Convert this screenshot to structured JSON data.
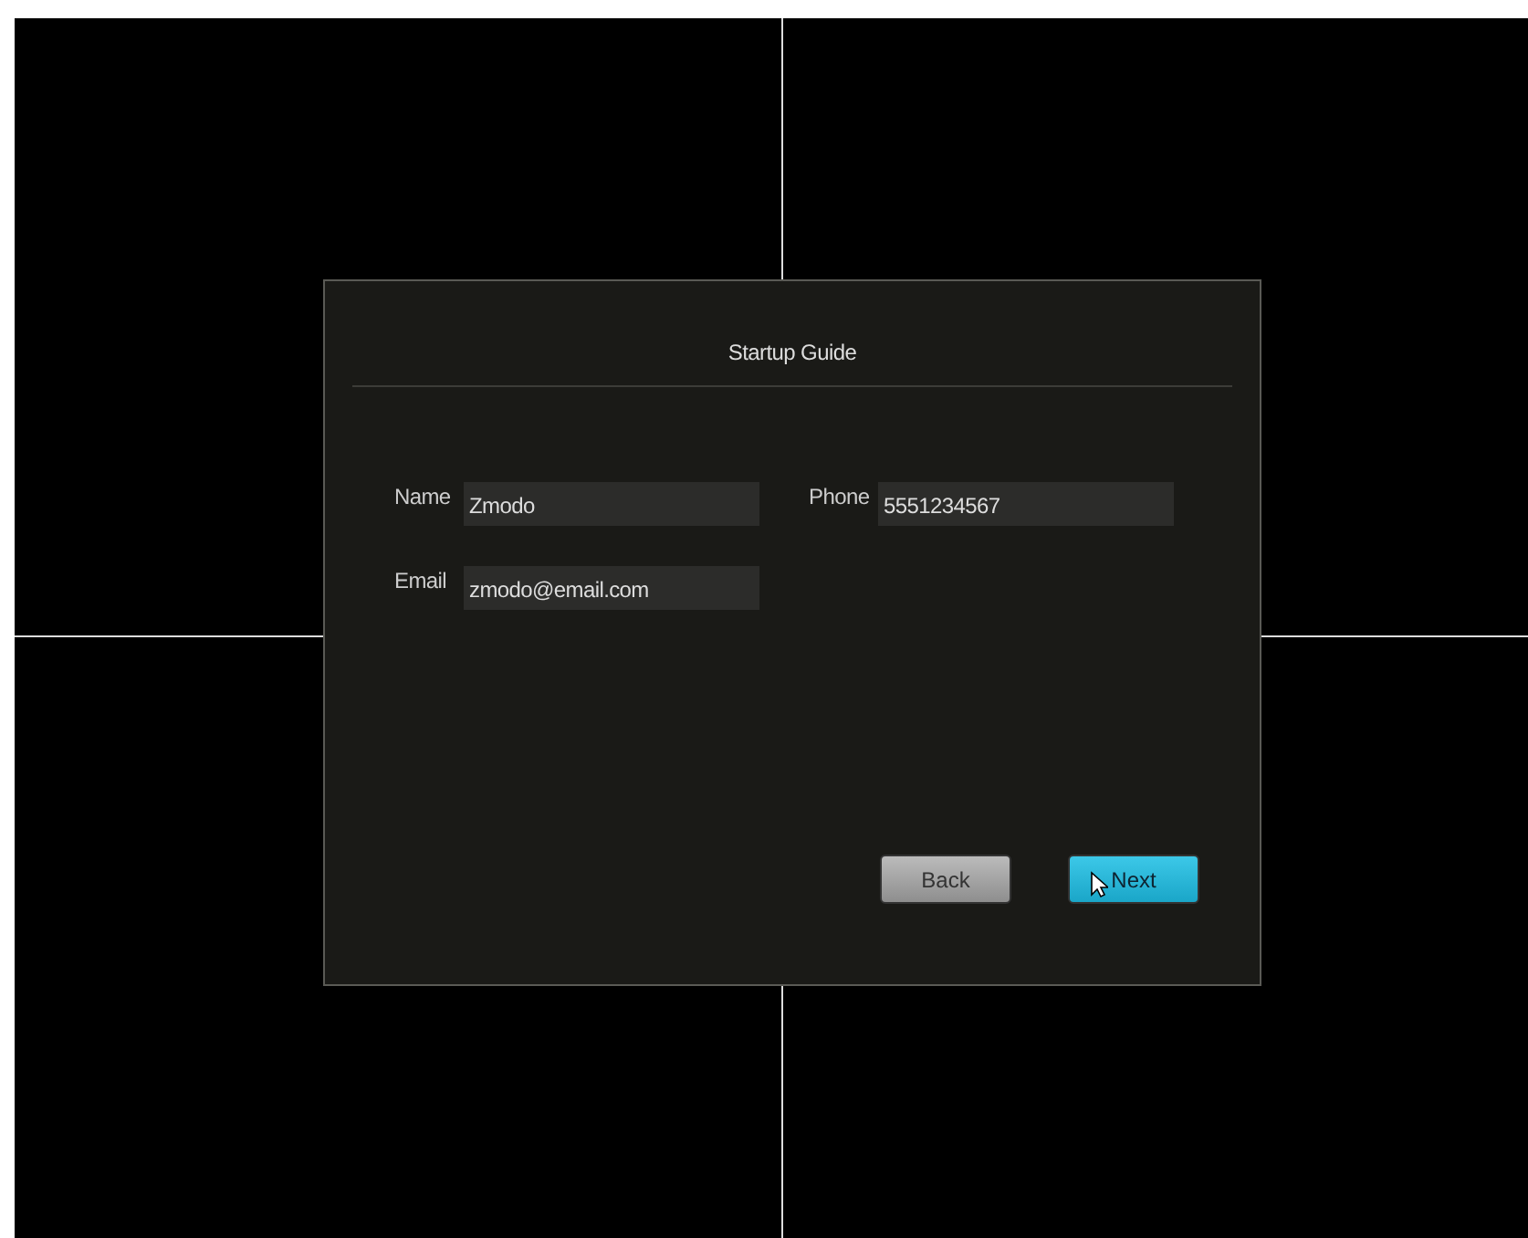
{
  "dialog": {
    "title": "Startup Guide",
    "fields": [
      {
        "label": "Name",
        "value": "Zmodo"
      },
      {
        "label": "Phone",
        "value": "5551234567"
      },
      {
        "label": "Email",
        "value": "zmodo@email.com"
      }
    ],
    "buttons": [
      {
        "label": "Back",
        "kind": "secondary"
      },
      {
        "label": "Next",
        "kind": "primary"
      }
    ]
  }
}
